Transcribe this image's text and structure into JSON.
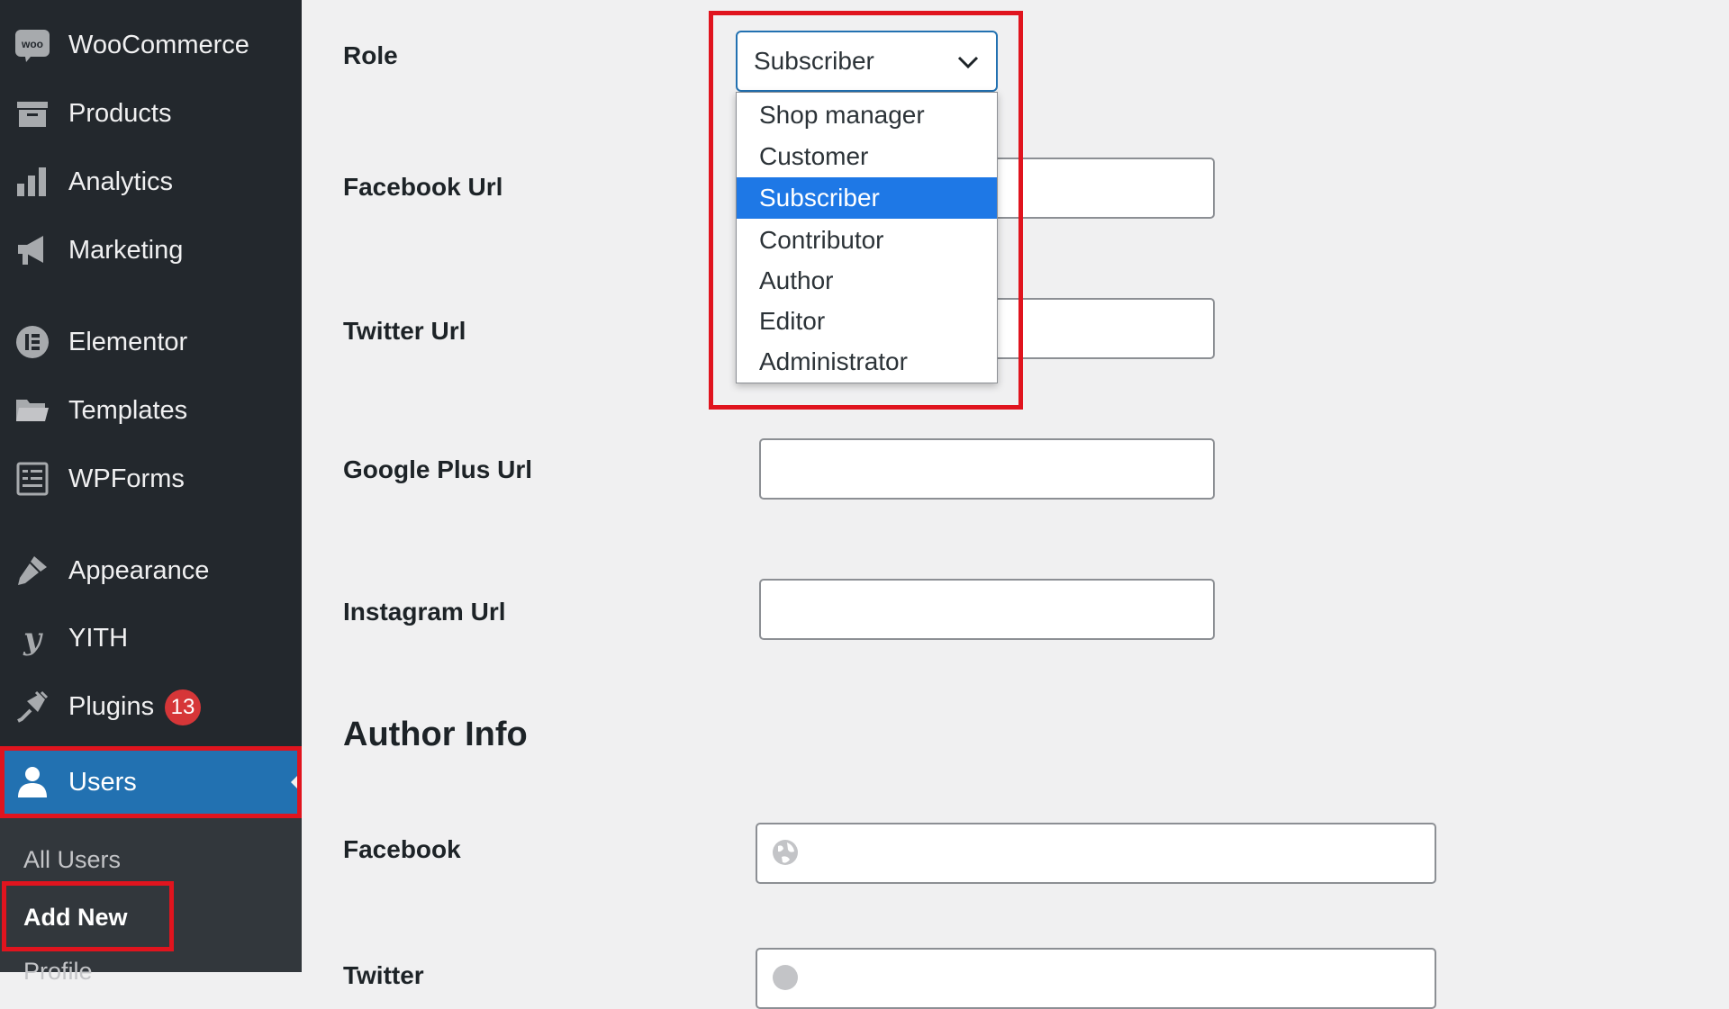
{
  "sidebar": {
    "items": [
      {
        "label": "WooCommerce",
        "icon": "woo-icon"
      },
      {
        "label": "Products",
        "icon": "archive-icon"
      },
      {
        "label": "Analytics",
        "icon": "bar-chart-icon"
      },
      {
        "label": "Marketing",
        "icon": "megaphone-icon"
      },
      {
        "label": "Elementor",
        "icon": "elementor-icon"
      },
      {
        "label": "Templates",
        "icon": "folder-icon"
      },
      {
        "label": "WPForms",
        "icon": "form-icon"
      },
      {
        "label": "Appearance",
        "icon": "brush-icon"
      },
      {
        "label": "YITH",
        "icon": "yith-icon"
      },
      {
        "label": "Plugins",
        "icon": "plug-icon",
        "badge": "13"
      },
      {
        "label": "Users",
        "icon": "user-icon",
        "active": true
      }
    ],
    "woo_logo_text": "woo",
    "submenu": [
      {
        "label": "All Users"
      },
      {
        "label": "Add New",
        "current": true
      },
      {
        "label": "Profile"
      }
    ]
  },
  "form": {
    "role": {
      "label": "Role",
      "selected": "Subscriber",
      "options": [
        "Shop manager",
        "Customer",
        "Subscriber",
        "Contributor",
        "Author",
        "Editor",
        "Administrator"
      ]
    },
    "facebook_url": {
      "label": "Facebook Url",
      "value": ""
    },
    "twitter_url": {
      "label": "Twitter Url",
      "value": ""
    },
    "google_plus_url": {
      "label": "Google Plus Url",
      "value": ""
    },
    "instagram_url": {
      "label": "Instagram Url",
      "value": ""
    },
    "author_info": {
      "title": "Author Info",
      "facebook": {
        "label": "Facebook",
        "value": ""
      },
      "twitter": {
        "label": "Twitter",
        "value": ""
      }
    }
  },
  "colors": {
    "sidebar_bg": "#23282d",
    "active_item": "#2271b1",
    "highlight": "#e0141e",
    "badge": "#d63638",
    "selected_option": "#1e78e6"
  }
}
